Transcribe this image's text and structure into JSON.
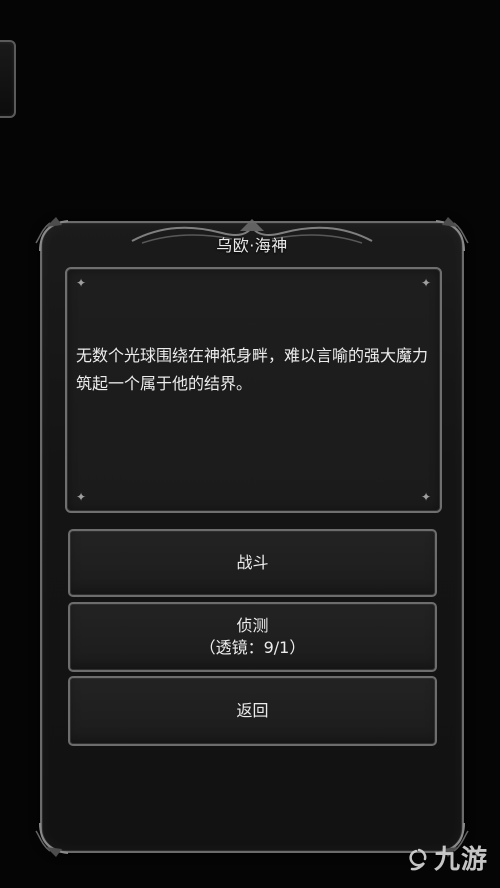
{
  "dialog": {
    "title": "乌欧·海神",
    "description": "无数个光球围绕在神祇身畔，难以言喻的强大魔力筑起一个属于他的结界。"
  },
  "actions": {
    "fight": "战斗",
    "detect": "侦测",
    "detect_detail": "（透镜：9/1）",
    "return": "返回"
  },
  "watermark": {
    "text": "九游"
  },
  "colors": {
    "background": "#050505",
    "frame": "#6b6b6b",
    "panel": "#1b1b1b",
    "text": "#ececec"
  },
  "icons": {
    "side_tab": "edge-tab-icon",
    "corner": "ornament-corner-icon",
    "sparkle": "sparkle-icon",
    "watermark_logo": "nine-game-logo-icon"
  }
}
